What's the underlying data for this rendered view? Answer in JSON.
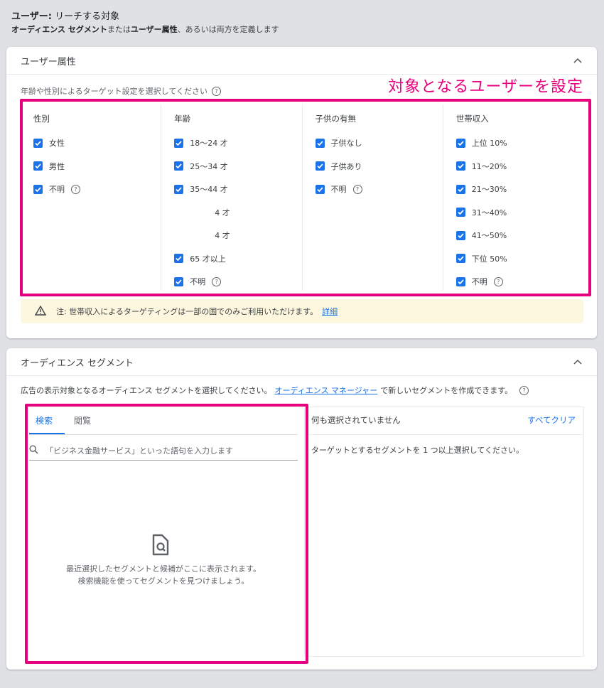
{
  "header": {
    "title_bold": "ユーザー:",
    "title_rest": " リーチする対象",
    "subtitle_b1": "オーディエンス セグメント",
    "subtitle_t1": "または",
    "subtitle_b2": "ユーザー属性",
    "subtitle_t2": "、あるいは両方を定義します"
  },
  "demographics": {
    "title": "ユーザー属性",
    "hint": "年齢や性別によるターゲット設定を選択してください",
    "annotation": "対象となるユーザーを設定",
    "columns": [
      {
        "title": "性別",
        "options": [
          {
            "label": "女性",
            "checked": true
          },
          {
            "label": "男性",
            "checked": true
          },
          {
            "label": "不明",
            "checked": true,
            "help": true
          }
        ]
      },
      {
        "title": "年齢",
        "options": [
          {
            "label": "18〜24 才",
            "checked": true
          },
          {
            "label": "25〜34 才",
            "checked": true
          },
          {
            "label": "35〜44 才",
            "checked": true
          },
          {
            "label": "4 才",
            "checked": false,
            "obscured": true
          },
          {
            "label": "4 才",
            "checked": false,
            "obscured": true
          },
          {
            "label": "65 才以上",
            "checked": true
          },
          {
            "label": "不明",
            "checked": true,
            "help": true
          }
        ]
      },
      {
        "title": "子供の有無",
        "options": [
          {
            "label": "子供なし",
            "checked": true
          },
          {
            "label": "子供あり",
            "checked": true
          },
          {
            "label": "不明",
            "checked": true,
            "help": true
          }
        ]
      },
      {
        "title": "世帯収入",
        "options": [
          {
            "label": "上位 10%",
            "checked": true
          },
          {
            "label": "11〜20%",
            "checked": true
          },
          {
            "label": "21〜30%",
            "checked": true
          },
          {
            "label": "31〜40%",
            "checked": true
          },
          {
            "label": "41〜50%",
            "checked": true
          },
          {
            "label": "下位 50%",
            "checked": true
          },
          {
            "label": "不明",
            "checked": true,
            "help": true
          }
        ]
      }
    ],
    "warning": "注: 世帯収入によるターゲティングは一部の国でのみご利用いただけます。",
    "warning_link": "詳細"
  },
  "segments": {
    "title": "オーディエンス セグメント",
    "desc_before": "広告の表示対象となるオーディエンス セグメントを選択してください。",
    "desc_link": "オーディエンス マネージャー",
    "desc_after": "で新しいセグメントを作成できます。",
    "tabs": [
      "検索",
      "閲覧"
    ],
    "search_placeholder": "「ビジネス金融サービス」といった語句を入力します",
    "empty_line1": "最近選択したセグメントと候補がここに表示されます。",
    "empty_line2": "検索機能を使ってセグメントを見つけましょう。",
    "selected_title": "何も選択されていません",
    "clear_all": "すべてクリア",
    "selected_hint": "ターゲットとするセグメントを 1 つ以上選択してください。"
  },
  "colors": {
    "accent": "#1a73e8",
    "highlight": "#e6007e",
    "warning_bg": "#fef7e0"
  }
}
